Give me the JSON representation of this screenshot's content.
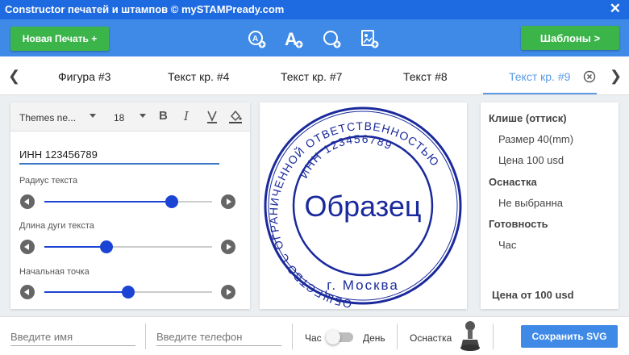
{
  "window": {
    "title": "Constructor печатей и штампов © mySTAMPready.com"
  },
  "toolbar": {
    "new_stamp_label": "Новая Печать +",
    "templates_label": "Шаблоны  >"
  },
  "tabs": [
    {
      "label": "Фигура #3"
    },
    {
      "label": "Текст кр. #4"
    },
    {
      "label": "Текст кр. #7"
    },
    {
      "label": "Текст #8"
    },
    {
      "label": "Текст кр. #9"
    }
  ],
  "editor": {
    "font_family": "Themes ne...",
    "font_size": "18",
    "text_value": "ИНН 123456789",
    "sliders": [
      {
        "label": "Радиус текста",
        "value": 0.76
      },
      {
        "label": "Длина дуги текста",
        "value": 0.37
      },
      {
        "label": "Начальная точка",
        "value": 0.5
      }
    ]
  },
  "stamp": {
    "outer_text": "ОБЩЕСТВО С ОГРАНИЧЕННОЙ ОТВЕТСТВЕННОСТЬЮ",
    "inner_text": "ИНН 123456789",
    "center_text": "Образец",
    "bottom_text": "г. Москва",
    "color": "#1a2a9c"
  },
  "info": {
    "cliche_heading": "Клише (оттиск)",
    "size": "Размер 40(mm)",
    "price": "Цена 100 usd",
    "equipment_heading": "Оснастка",
    "equipment_value": "Не выбранна",
    "readiness_heading": "Готовность",
    "readiness_value": "Час",
    "total": "Цена от 100 usd"
  },
  "footer": {
    "name_placeholder": "Введите имя",
    "phone_placeholder": "Введите телефон",
    "hour_label": "Час",
    "day_label": "День",
    "equipment_label": "Оснастка",
    "save_label": "Сохранить SVG"
  }
}
